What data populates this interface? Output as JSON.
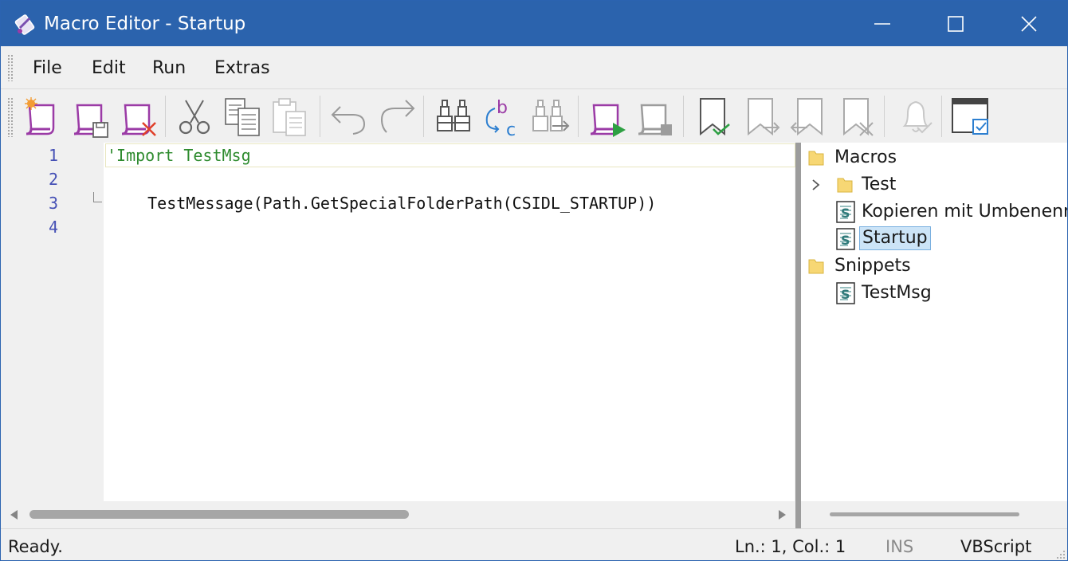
{
  "window": {
    "title": "Macro Editor - Startup"
  },
  "colors": {
    "titlebar": "#2b63ad",
    "accent_purple": "#9b3ba6",
    "run_green": "#2ea043",
    "comment_green": "#2e8b2e",
    "line_numbers": "#4550b5"
  },
  "menu": {
    "items": [
      "File",
      "Edit",
      "Run",
      "Extras"
    ]
  },
  "toolbar": {
    "buttons": [
      "new-macro-icon",
      "save-macro-icon",
      "delete-macro-icon",
      "cut-icon",
      "copy-icon",
      "paste-icon",
      "undo-icon",
      "redo-icon",
      "find-icon",
      "replace-icon",
      "find-next-icon",
      "run-macro-icon",
      "stop-macro-icon",
      "toggle-bookmark-icon",
      "next-bookmark-icon",
      "previous-bookmark-icon",
      "clear-bookmarks-icon",
      "notification-icon",
      "window-icon"
    ]
  },
  "editor": {
    "line_numbers": [
      "1",
      "2",
      "3",
      "4"
    ],
    "lines": [
      {
        "text": "'Import TestMsg",
        "style": "comment"
      },
      {
        "text": "",
        "style": "normal"
      },
      {
        "text": "   TestMessage(Path.GetSpecialFolderPath(CSIDL_STARTUP))",
        "style": "normal"
      },
      {
        "text": "",
        "style": "normal"
      }
    ]
  },
  "tree": {
    "macros_label": "Macros",
    "test_label": "Test",
    "kopieren_label": "Kopieren mit Umbenennen",
    "startup_label": "Startup",
    "snippets_label": "Snippets",
    "testmsg_label": "TestMsg"
  },
  "status": {
    "message": "Ready.",
    "position": "Ln.: 1, Col.: 1",
    "mode": "INS",
    "language": "VBScript"
  }
}
